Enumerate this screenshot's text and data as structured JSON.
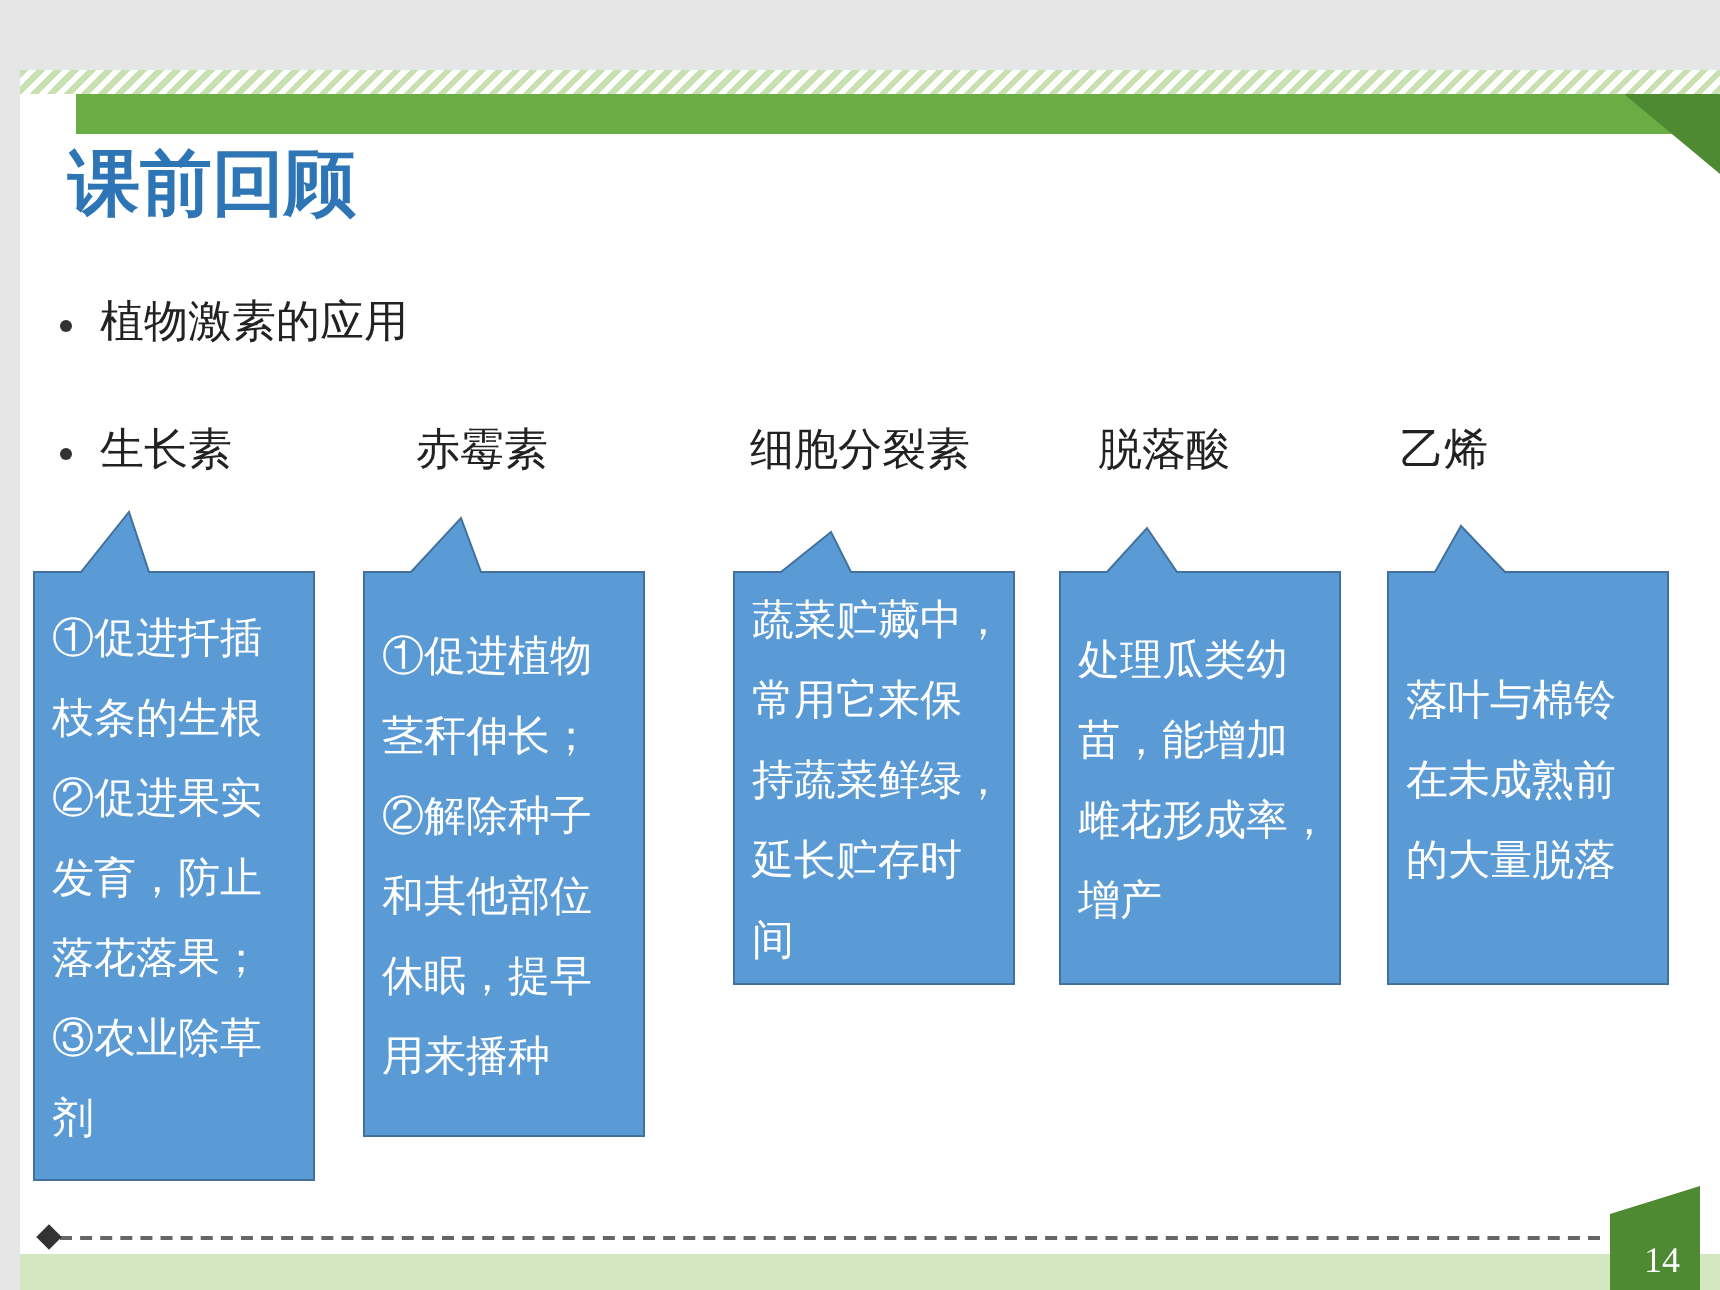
{
  "title": "课前回顾",
  "bullets": [
    {
      "text": "植物激素的应用"
    }
  ],
  "hormones": [
    {
      "name": "生长素",
      "description_lines": [
        "①促进扦插",
        "枝条的生根",
        "②促进果实",
        "发育，防止",
        "落花落果；",
        "③农业除草",
        "剂"
      ]
    },
    {
      "name": "赤霉素",
      "description_lines": [
        "①促进植物",
        "茎秆伸长；",
        "②解除种子",
        "和其他部位",
        "休眠，提早",
        "用来播种"
      ]
    },
    {
      "name": "细胞分裂素",
      "description_lines": [
        "蔬菜贮藏中，",
        "常用它来保",
        "持蔬菜鲜绿，",
        "延长贮存时",
        "间"
      ]
    },
    {
      "name": "脱落酸",
      "description_lines": [
        "处理瓜类幼",
        "苗，能增加",
        "雌花形成率，",
        "增产"
      ]
    },
    {
      "name": "乙烯",
      "description_lines": [
        "落叶与棉铃",
        "在未成熟前",
        "的大量脱落"
      ]
    }
  ],
  "page_number": "14"
}
